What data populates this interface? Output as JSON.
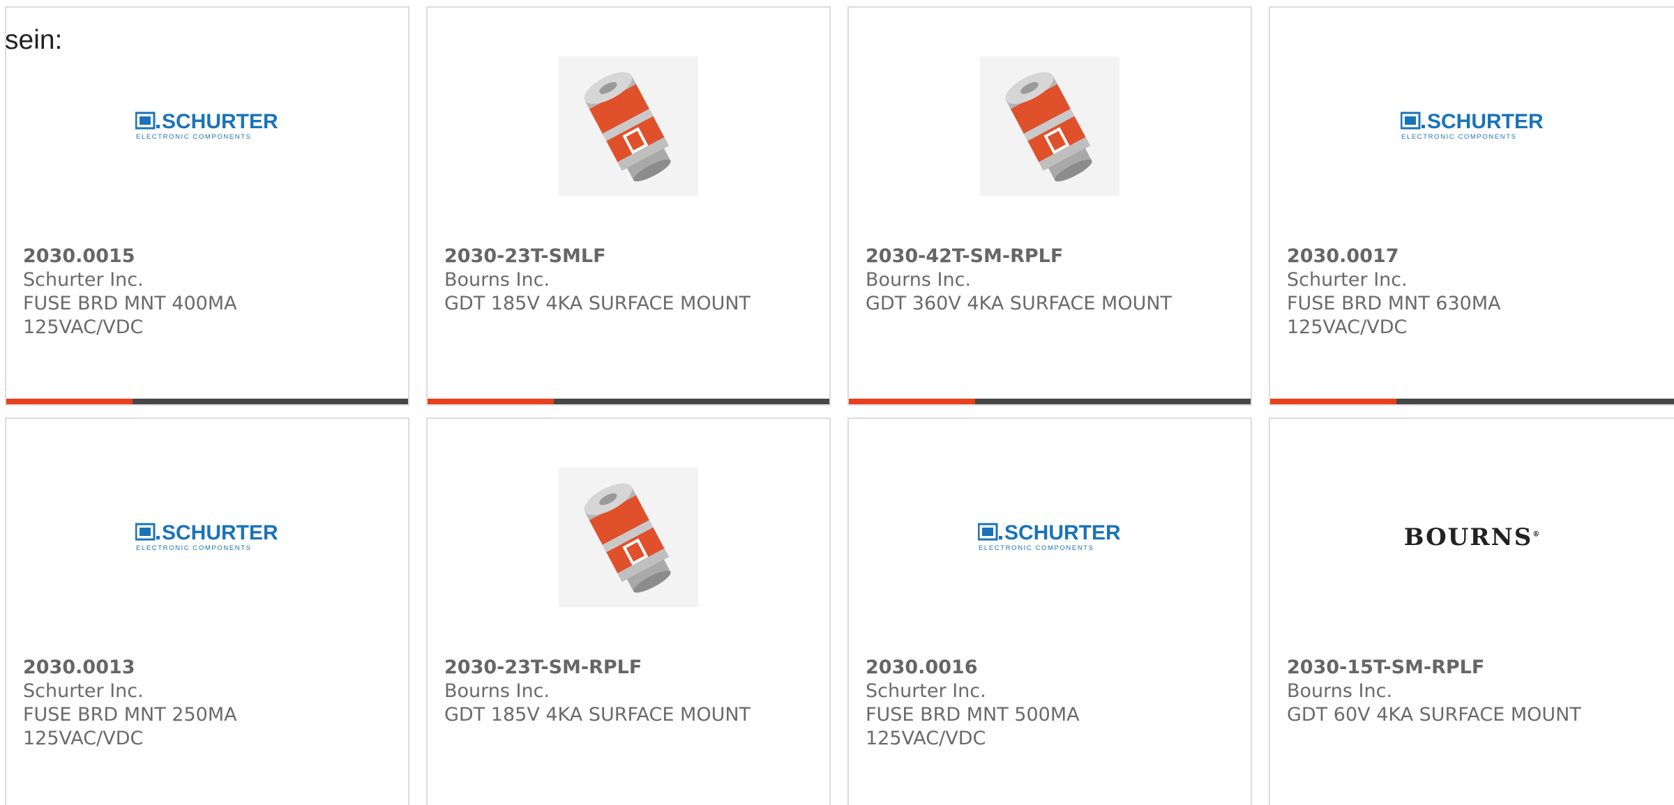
{
  "heading": "sein:",
  "colors": {
    "accent": "#e8401c",
    "bar_dark": "#474747",
    "schurter_blue": "#1a73b8"
  },
  "logos": {
    "schurter_main": "SCHURTER",
    "schurter_sub": "ELECTRONIC COMPONENTS",
    "bourns": "BOURNS"
  },
  "products": [
    {
      "part": "2030.0015",
      "mfr": "Schurter Inc.",
      "desc": "FUSE BRD MNT 400MA 125VAC/VDC",
      "image": "schurter-logo"
    },
    {
      "part": "2030-23T-SMLF",
      "mfr": "Bourns Inc.",
      "desc": "GDT 185V 4KA SURFACE MOUNT",
      "image": "gdt-component"
    },
    {
      "part": "2030-42T-SM-RPLF",
      "mfr": "Bourns Inc.",
      "desc": "GDT 360V 4KA SURFACE MOUNT",
      "image": "gdt-component"
    },
    {
      "part": "2030.0017",
      "mfr": "Schurter Inc.",
      "desc": "FUSE BRD MNT 630MA 125VAC/VDC",
      "image": "schurter-logo"
    },
    {
      "part": "2030.0013",
      "mfr": "Schurter Inc.",
      "desc": "FUSE BRD MNT 250MA 125VAC/VDC",
      "image": "schurter-logo"
    },
    {
      "part": "2030-23T-SM-RPLF",
      "mfr": "Bourns Inc.",
      "desc": "GDT 185V 4KA SURFACE MOUNT",
      "image": "gdt-component"
    },
    {
      "part": "2030.0016",
      "mfr": "Schurter Inc.",
      "desc": "FUSE BRD MNT 500MA 125VAC/VDC",
      "image": "schurter-logo"
    },
    {
      "part": "2030-15T-SM-RPLF",
      "mfr": "Bourns Inc.",
      "desc": "GDT 60V 4KA SURFACE MOUNT",
      "image": "bourns-logo"
    }
  ]
}
